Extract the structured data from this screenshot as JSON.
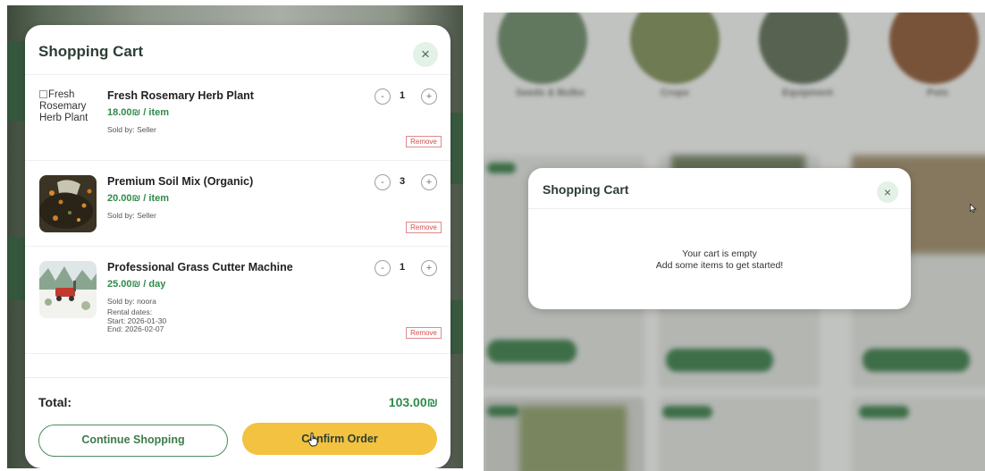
{
  "left_cart": {
    "title": "Shopping Cart",
    "close_icon": "×",
    "items": [
      {
        "image_alt": "Fresh Rosemary Herb Plant",
        "name": "Fresh Rosemary Herb Plant",
        "price": "18.00₪ / item",
        "seller": "Sold by: Seller",
        "quantity": "1",
        "remove_label": "Remove"
      },
      {
        "name": "Premium Soil Mix (Organic)",
        "price": "20.00₪ / item",
        "seller": "Sold by: Seller",
        "quantity": "3",
        "remove_label": "Remove"
      },
      {
        "name": "Professional Grass Cutter Machine",
        "price": "25.00₪ / day",
        "seller": "Sold by: noora",
        "rental_label": "Rental dates:",
        "rental_start": "Start: 2026-01-30",
        "rental_end": "End: 2026-02-07",
        "quantity": "1",
        "remove_label": "Remove"
      }
    ],
    "minus_symbol": "-",
    "plus_symbol": "+",
    "total_label": "Total:",
    "total_value": "103.00₪",
    "continue_label": "Continue Shopping",
    "confirm_label": "Confirm Order"
  },
  "right_cart": {
    "title": "Shopping Cart",
    "close_icon": "×",
    "empty_line1": "Your cart is empty",
    "empty_line2": "Add some items to get started!"
  },
  "background_categories": [
    "Seeds & Bulbs",
    "Crops",
    "Equipment",
    "Pots"
  ],
  "colors": {
    "accent_green": "#2f8a4a",
    "confirm_yellow": "#f2c240",
    "remove_red": "#d05050",
    "close_bg": "#e3f1e6"
  },
  "icons": {
    "close": "close-icon",
    "minus": "minus-icon",
    "plus": "plus-icon",
    "cursor_pointer": "hand-cursor-icon",
    "cursor_arrow": "arrow-cursor-icon"
  }
}
